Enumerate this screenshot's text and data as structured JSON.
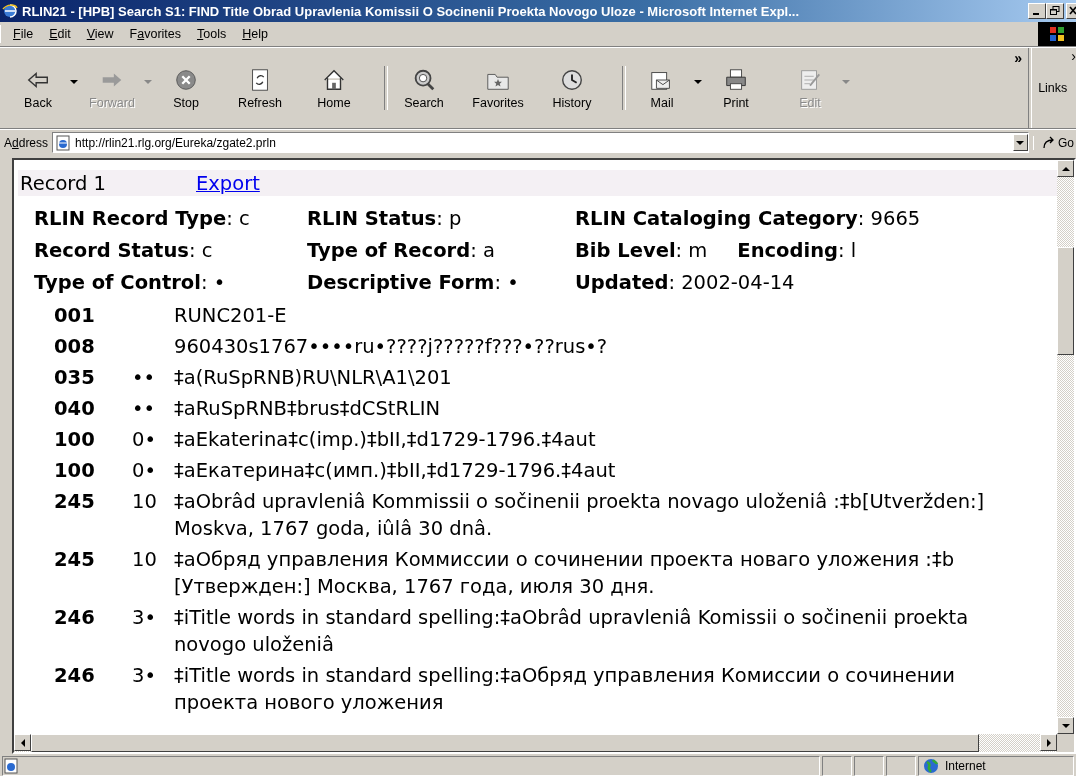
{
  "window": {
    "title": "RLIN21 - [HPB] Search S1: FIND Title Obrad Upravlenia Komissii O Socinenii Proekta Novogo Uloze - Microsoft Internet Expl..."
  },
  "menu": [
    {
      "key": "F",
      "post": "ile"
    },
    {
      "key": "E",
      "post": "dit"
    },
    {
      "key": "V",
      "post": "iew"
    },
    {
      "pre": "F",
      "key": "a",
      "post": "vorites"
    },
    {
      "key": "T",
      "post": "ools"
    },
    {
      "key": "H",
      "post": "elp"
    }
  ],
  "toolbar": [
    {
      "kind": "button",
      "label": "Back",
      "disabled": false,
      "dropdown": true
    },
    {
      "kind": "button",
      "label": "Forward",
      "disabled": true,
      "dropdown": true
    },
    {
      "kind": "button",
      "label": "Stop",
      "disabled": false,
      "dropdown": false
    },
    {
      "kind": "button",
      "label": "Refresh",
      "disabled": false,
      "dropdown": false
    },
    {
      "kind": "button",
      "label": "Home",
      "disabled": false,
      "dropdown": false
    },
    {
      "kind": "separator"
    },
    {
      "kind": "button",
      "label": "Search",
      "disabled": false,
      "dropdown": false
    },
    {
      "kind": "button",
      "label": "Favorites",
      "disabled": false,
      "dropdown": false
    },
    {
      "kind": "button",
      "label": "History",
      "disabled": false,
      "dropdown": false
    },
    {
      "kind": "separator"
    },
    {
      "kind": "button",
      "label": "Mail",
      "disabled": false,
      "dropdown": true
    },
    {
      "kind": "button",
      "label": "Print",
      "disabled": false,
      "dropdown": false
    },
    {
      "kind": "button",
      "label": "Edit",
      "disabled": true,
      "dropdown": true
    }
  ],
  "links": {
    "chevron": "»",
    "label": "Links",
    "chevron2": "›"
  },
  "address_bar": {
    "label_pre": "A",
    "label_key": "d",
    "label_post": "dress",
    "url": "http://rlin21.rlg.org/Eureka/zgate2.prln",
    "go": "Go"
  },
  "record_bar": {
    "record": "Record 1",
    "export": "Export"
  },
  "header": [
    [
      {
        "label": "RLIN Record Type",
        "value": ": c"
      },
      {
        "label": "RLIN Status",
        "value": ": p"
      },
      {
        "label": "RLIN Cataloging Category",
        "value": ": 9665"
      }
    ],
    [
      {
        "label": "Record Status",
        "value": ": c"
      },
      {
        "label": "Type of Record",
        "value": ": a"
      },
      {
        "label": "Bib Level",
        "value": ": m"
      },
      {
        "label": "Encoding",
        "value": ": l"
      }
    ],
    [
      {
        "label": "Type of Control",
        "value": ": •"
      },
      {
        "label": "Descriptive Form",
        "value": ": •"
      },
      {
        "label": "Updated",
        "value": ": 2002-04-14"
      }
    ]
  ],
  "fields": [
    {
      "tag": "001",
      "lines": [
        "RUNC201-E"
      ]
    },
    {
      "tag": "008",
      "lines": [
        "960430s1767••••ru•????j?????f???•??rus•?"
      ]
    },
    {
      "tag": "035",
      "indicators": "••",
      "lines": [
        "‡a(RuSpRNB)RU\\NLR\\A1\\201"
      ]
    },
    {
      "tag": "040",
      "indicators": "••",
      "lines": [
        "‡aRuSpRNB‡brus‡dCStRLIN"
      ]
    },
    {
      "tag": "100",
      "indicators": "0•",
      "lines": [
        "‡aEkaterina‡c(imp.)‡bII,‡d1729-1796.‡4aut"
      ]
    },
    {
      "tag": "100",
      "indicators": "0•",
      "lines": [
        "‡aЕкатерина‡c(имп.)‡bII,‡d1729-1796.‡4aut"
      ]
    },
    {
      "tag": "245",
      "indicators": "10",
      "lines": [
        "‡aObrâd upravleniâ Kommissii o sočinenii proekta novago uloženiâ :‡b[Utveržden:]",
        "Moskva, 1767 goda, iûlâ 30 dnâ."
      ]
    },
    {
      "tag": "245",
      "indicators": "10",
      "lines": [
        "‡aОбряд управления Коммиссии о сочинении проекта новаго уложения :‡b",
        "[Утвержден:] Москва, 1767 года, июля 30 дня."
      ]
    },
    {
      "tag": "246",
      "indicators": "3•",
      "lines": [
        "‡iTitle words in standard spelling:‡aObrâd upravleniâ Komissii o sočinenii proekta",
        "novogo uloženiâ"
      ]
    },
    {
      "tag": "246",
      "indicators": "3•",
      "lines": [
        "‡iTitle words in standard spelling:‡aОбряд управления Комиссии о сочинении",
        "проекта нового уложения"
      ]
    }
  ],
  "status_bar": {
    "zone": "Internet"
  }
}
